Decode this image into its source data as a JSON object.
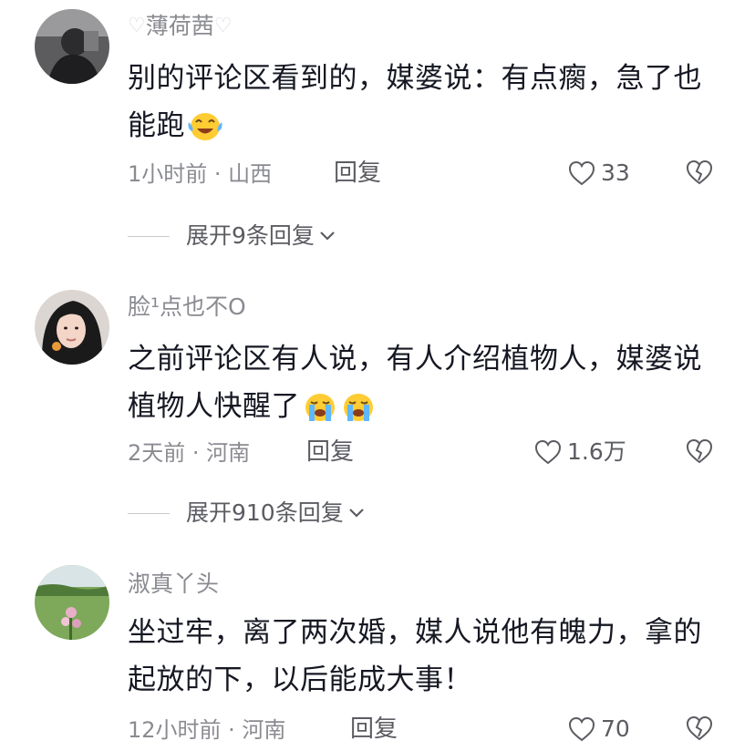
{
  "comments": [
    {
      "username": "薄荷茜",
      "username_decor": "♡",
      "text": "别的评论区看到的，媒婆说：有点瘸，急了也能跑",
      "time_location": "1小时前 · 山西",
      "reply_label": "回复",
      "likes": "33",
      "expand_label": "展开9条回复"
    },
    {
      "username": "脸¹点也不O",
      "text": "之前评论区有人说，有人介绍植物人，媒婆说植物人快醒了",
      "time_location": "2天前 · 河南",
      "reply_label": "回复",
      "likes": "1.6万",
      "expand_label": "展开910条回复"
    },
    {
      "username": "淑真丫头",
      "text": "坐过牢，离了两次婚，媒人说他有魄力，拿的起放的下，以后能成大事！",
      "time_location": "12小时前 · 河南",
      "reply_label": "回复",
      "likes": "70"
    }
  ],
  "icons": {
    "like": "heart-outline-icon",
    "dislike": "broken-heart-icon",
    "expand": "chevron-down-icon",
    "emoji_laugh": "laughing-tears-emoji",
    "emoji_cry": "crying-emoji"
  },
  "colors": {
    "text": "#161823",
    "secondary": "#8a8b91",
    "action": "#5b5c62"
  }
}
